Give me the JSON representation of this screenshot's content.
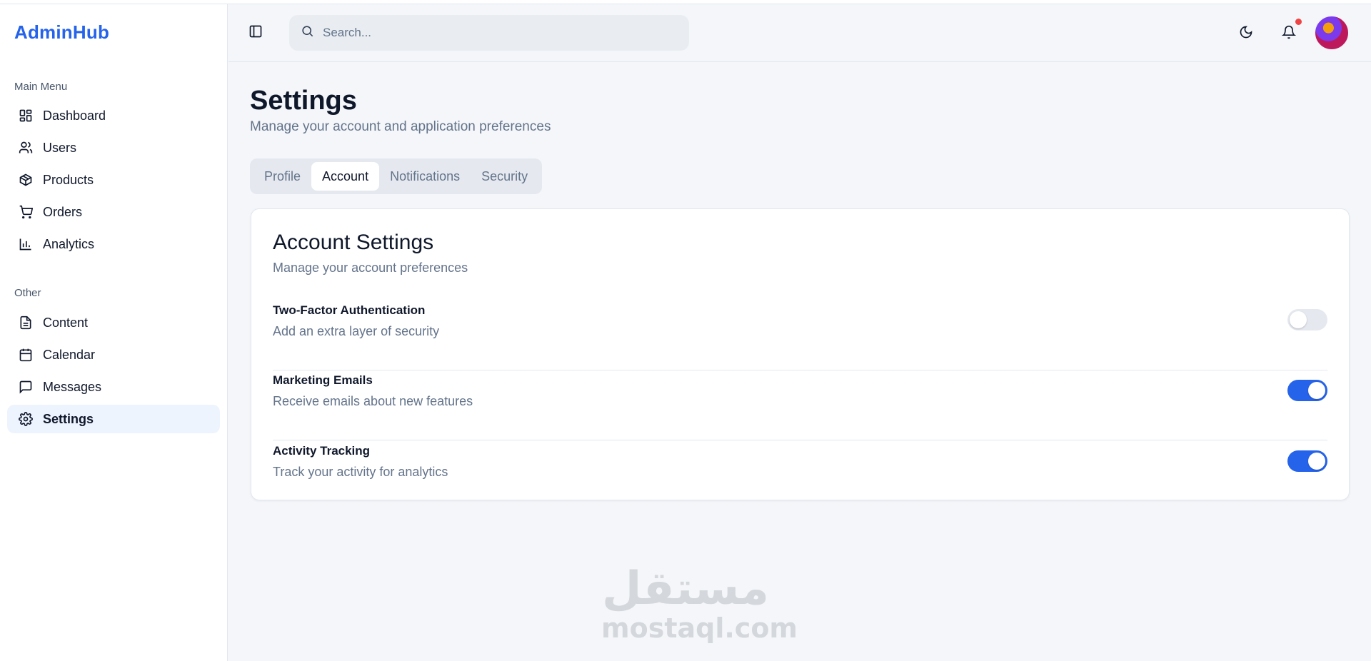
{
  "app": {
    "brand": "AdminHub"
  },
  "sidebar": {
    "sections": [
      {
        "label": "Main Menu"
      },
      {
        "label": "Other"
      }
    ],
    "items": [
      {
        "label": "Dashboard",
        "icon": "dashboard-icon"
      },
      {
        "label": "Users",
        "icon": "users-icon"
      },
      {
        "label": "Products",
        "icon": "package-icon"
      },
      {
        "label": "Orders",
        "icon": "cart-icon"
      },
      {
        "label": "Analytics",
        "icon": "bar-chart-icon"
      },
      {
        "label": "Content",
        "icon": "document-icon"
      },
      {
        "label": "Calendar",
        "icon": "calendar-icon"
      },
      {
        "label": "Messages",
        "icon": "message-icon"
      },
      {
        "label": "Settings",
        "icon": "gear-icon",
        "active": true
      }
    ]
  },
  "header": {
    "search_placeholder": "Search...",
    "has_notification": true
  },
  "page": {
    "title": "Settings",
    "subtitle": "Manage your account and application preferences"
  },
  "tabs": [
    {
      "label": "Profile"
    },
    {
      "label": "Account",
      "active": true
    },
    {
      "label": "Notifications"
    },
    {
      "label": "Security"
    }
  ],
  "card": {
    "title": "Account Settings",
    "subtitle": "Manage your account preferences",
    "settings": [
      {
        "title": "Two-Factor Authentication",
        "description": "Add an extra layer of security",
        "enabled": false
      },
      {
        "title": "Marketing Emails",
        "description": "Receive emails about new features",
        "enabled": true
      },
      {
        "title": "Activity Tracking",
        "description": "Track your activity for analytics",
        "enabled": true
      }
    ]
  },
  "watermark": {
    "arabic": "مستقل",
    "latin": "mostaql.com"
  },
  "colors": {
    "accent": "#2563eb",
    "notification": "#ef4444",
    "active_nav_bg": "#eef4fd"
  }
}
